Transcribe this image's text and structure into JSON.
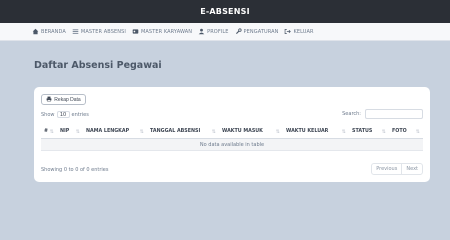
{
  "app": {
    "title": "E-ABSENSI"
  },
  "nav": {
    "items": [
      {
        "label": "BERANDA",
        "icon": "home-icon"
      },
      {
        "label": "MASTER ABSENSI",
        "icon": "list-icon"
      },
      {
        "label": "MASTER KARYAWAN",
        "icon": "id-card-icon"
      },
      {
        "label": "PROFILE",
        "icon": "user-icon"
      },
      {
        "label": "PENGATURAN",
        "icon": "wrench-icon"
      },
      {
        "label": "KELUAR",
        "icon": "logout-icon"
      }
    ]
  },
  "page": {
    "title": "Daftar Absensi Pegawai"
  },
  "toolbar": {
    "rekap_label": "Rekap Data"
  },
  "table_controls": {
    "show_prefix": "Show",
    "entries_value": "10",
    "show_suffix": "entries",
    "search_label": "Search:",
    "search_value": ""
  },
  "table": {
    "columns": [
      "#",
      "NIP",
      "NAMA LENGKAP",
      "TANGGAL ABSENSI",
      "WAKTU MASUK",
      "WAKTU KELUAR",
      "STATUS",
      "FOTO"
    ],
    "empty_text": "No data available in table"
  },
  "footer": {
    "info": "Showing 0 to 0 of 0 entries",
    "prev_label": "Previous",
    "next_label": "Next"
  },
  "colors": {
    "topbar": "#2b2f36",
    "page_bg": "#c7d1de",
    "card_bg": "#ffffff"
  }
}
